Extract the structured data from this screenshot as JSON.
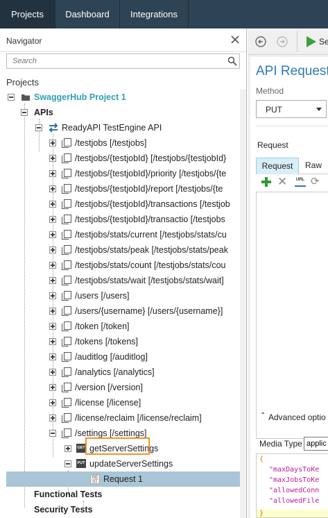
{
  "top_tabs": [
    "Projects",
    "Dashboard",
    "Integrations"
  ],
  "navigator": {
    "title": "Navigator",
    "search_placeholder": "Search",
    "projects_label": "Projects"
  },
  "tree": [
    {
      "label": "SwaggerHub Project 1",
      "kind": "project"
    },
    {
      "label": "APIs",
      "kind": "folder"
    },
    {
      "label": "ReadyAPI TestEngine API",
      "kind": "api"
    },
    {
      "label": "/testjobs [/testjobs]",
      "kind": "resource"
    },
    {
      "label": "/testjobs/{testjobId} [/testjobs/{testjobId}",
      "kind": "resource"
    },
    {
      "label": "/testjobs/{testjobId}/priority [/testjobs/{te",
      "kind": "resource"
    },
    {
      "label": "/testjobs/{testjobId}/report [/testjobs/{te",
      "kind": "resource"
    },
    {
      "label": "/testjobs/{testjobId}/transactions [/testjob",
      "kind": "resource"
    },
    {
      "label": "/testjobs/{testjobId}/transactio [/testjobs",
      "kind": "resource"
    },
    {
      "label": "/testjobs/stats/current [/testjobs/stats/cu",
      "kind": "resource"
    },
    {
      "label": "/testjobs/stats/peak [/testjobs/stats/peak",
      "kind": "resource"
    },
    {
      "label": "/testjobs/stats/count [/testjobs/stats/cou",
      "kind": "resource"
    },
    {
      "label": "/testjobs/stats/wait [/testjobs/stats/wait]",
      "kind": "resource"
    },
    {
      "label": "/users [/users]",
      "kind": "resource"
    },
    {
      "label": "/users/{username} [/users/{username}]",
      "kind": "resource"
    },
    {
      "label": "/token [/token]",
      "kind": "resource"
    },
    {
      "label": "/tokens [/tokens]",
      "kind": "resource"
    },
    {
      "label": "/auditlog [/auditlog]",
      "kind": "resource"
    },
    {
      "label": "/analytics [/analytics]",
      "kind": "resource"
    },
    {
      "label": "/version [/version]",
      "kind": "resource"
    },
    {
      "label": "/license [/license]",
      "kind": "resource"
    },
    {
      "label": "/license/reclaim [/license/reclaim]",
      "kind": "resource"
    },
    {
      "label": "/settings [/settings]",
      "kind": "resource-open"
    },
    {
      "label": "getServerSettings",
      "kind": "method-get",
      "badge": "GET"
    },
    {
      "label": "updateServerSettings",
      "kind": "method-put",
      "badge": "PUT"
    },
    {
      "label": "Request 1",
      "kind": "request",
      "badge": "RE ST"
    },
    {
      "label": "Functional Tests",
      "kind": "folder"
    },
    {
      "label": "Security Tests",
      "kind": "folder"
    }
  ],
  "editor": {
    "send_label": "Se",
    "title": "API Request",
    "method_label": "Method",
    "method_value": "PUT",
    "request_label": "Request",
    "tab_request": "Request",
    "tab_raw": "Raw",
    "url_icon_text": "URL",
    "advanced_label": "Advanced optio",
    "media_type_label": "Media Type",
    "media_type_value": "applic",
    "json_lines": [
      "{",
      "\"maxDaysToKe",
      "\"maxJobsToKe",
      "\"allowedConn",
      "\"allowedFile",
      "}"
    ]
  },
  "colors": {
    "topbar": "#2e4354",
    "project_link": "#2e9fb3",
    "selection": "#a9c5d6",
    "highlight_border": "#f0922b",
    "title_blue": "#2e7ab8",
    "send_green": "#3ca03c"
  }
}
